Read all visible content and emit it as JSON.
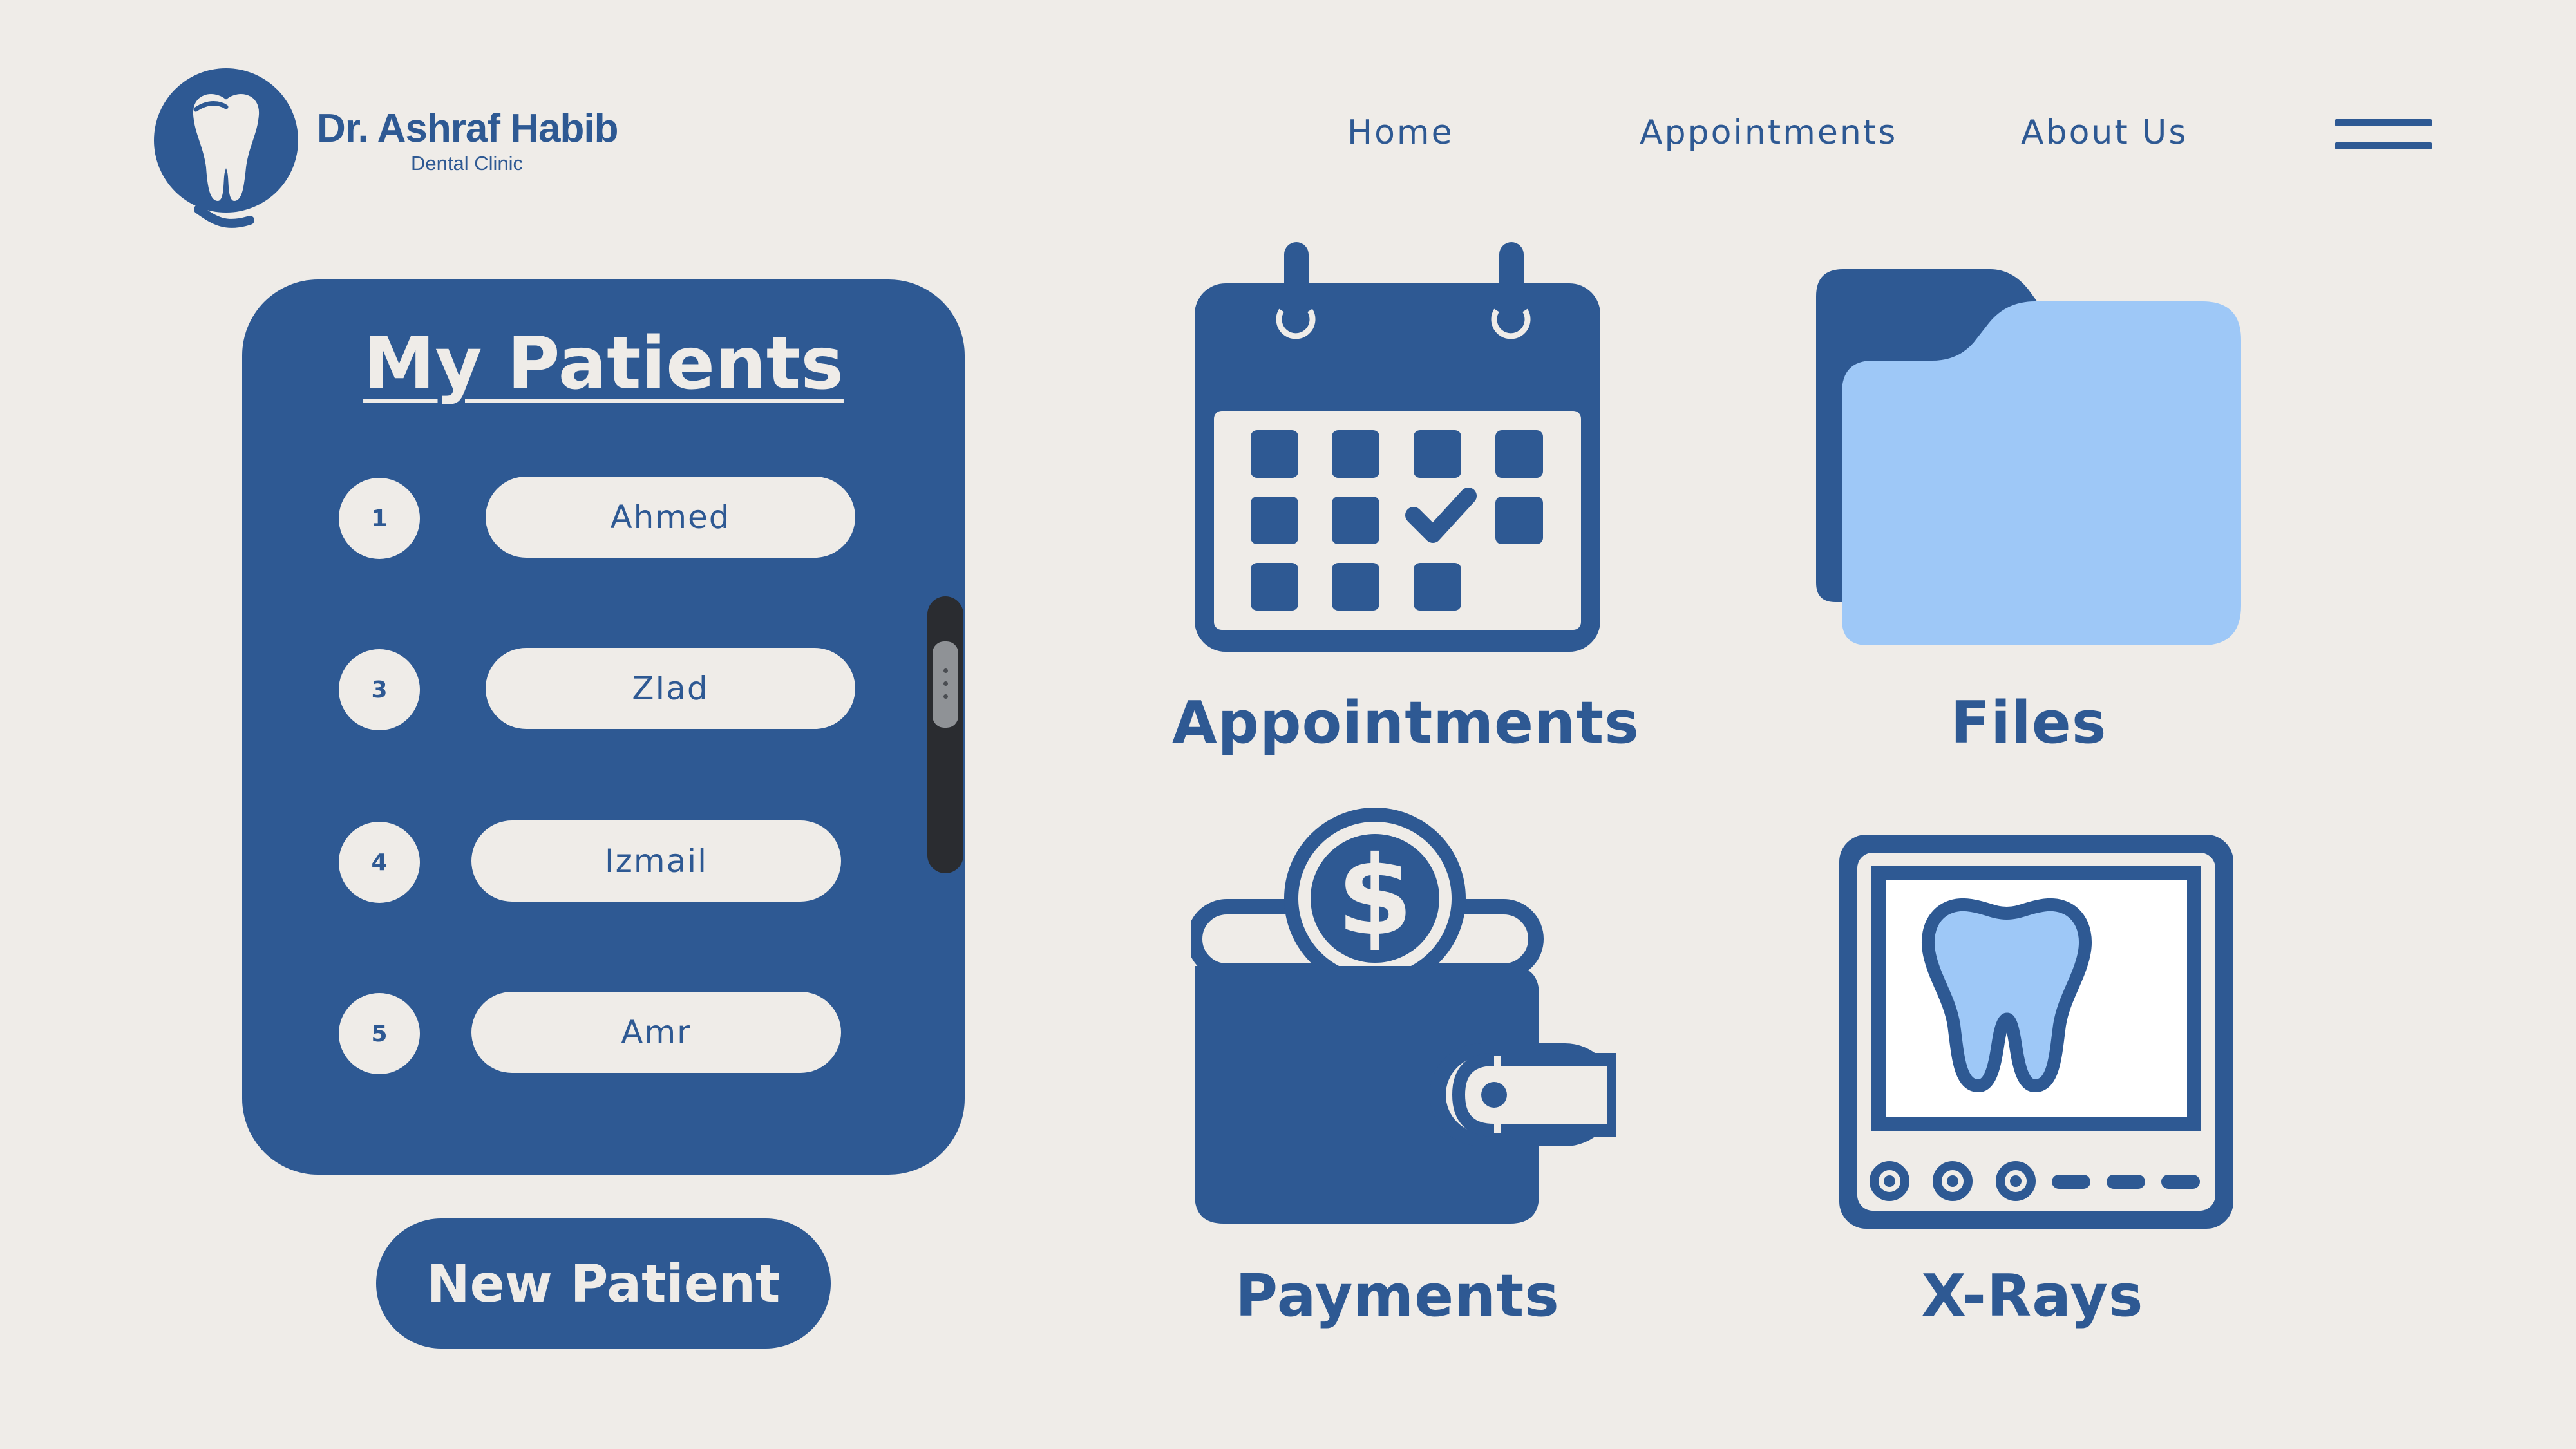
{
  "brand": {
    "name": "Dr. Ashraf Habib",
    "subtitle": "Dental Clinic"
  },
  "nav": {
    "items": [
      {
        "label": "Home"
      },
      {
        "label": "Appointments"
      },
      {
        "label": "About Us"
      }
    ],
    "menu_icon": "hamburger-menu-icon"
  },
  "patients": {
    "title": "My Patients",
    "rows": [
      {
        "number": "1",
        "name": "Ahmed"
      },
      {
        "number": "3",
        "name": "ZIad"
      },
      {
        "number": "4",
        "name": "Izmail"
      },
      {
        "number": "5",
        "name": "Amr"
      }
    ],
    "new_button": "New Patient"
  },
  "tiles": [
    {
      "label": "Appointments",
      "icon": "calendar-icon"
    },
    {
      "label": "Files",
      "icon": "folder-icon"
    },
    {
      "label": "Payments",
      "icon": "wallet-icon"
    },
    {
      "label": "X-Rays",
      "icon": "xray-monitor-icon"
    }
  ],
  "colors": {
    "background": "#efece8",
    "primary": "#2e5993",
    "accent": "#9ec8f7",
    "scrollbar": "#2a2c30"
  }
}
